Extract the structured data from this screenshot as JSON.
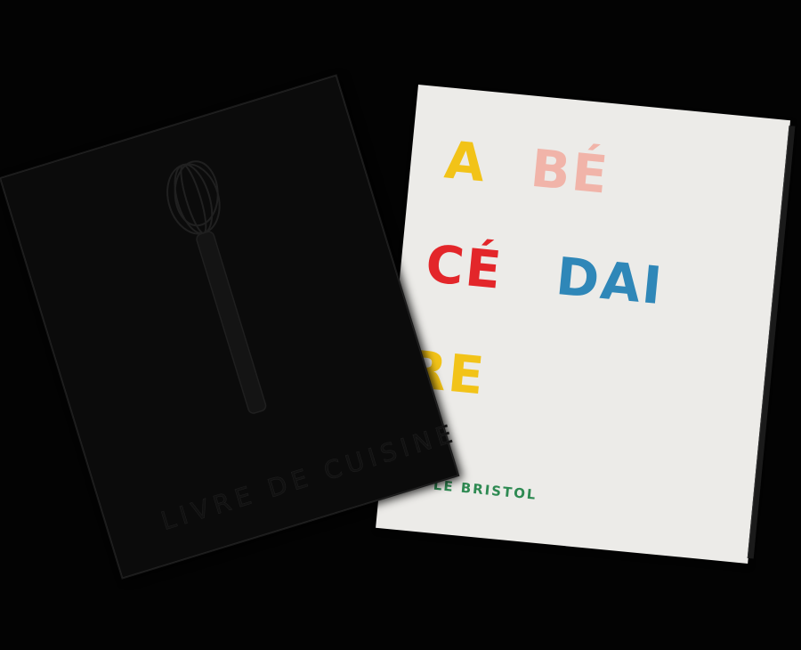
{
  "scene": {
    "background_color": "#000000"
  },
  "white_booklet": {
    "cover_color": "#ecebe8",
    "title_parts": [
      {
        "text": "A",
        "color": "#f2c318"
      },
      {
        "text": "BÉ",
        "color": "#f1b4a9"
      },
      {
        "text": "CÉ",
        "color": "#e3262a"
      },
      {
        "text": "DAI",
        "color": "#2f87b8"
      },
      {
        "text": "RE",
        "color": "#f2c318"
      }
    ],
    "publisher": {
      "text": "LE BRISTOL",
      "color": "#2e8a52"
    }
  },
  "dark_booklet": {
    "cover_color": "#0b0b0b",
    "title": "LIVRE DE CUISINE",
    "icon": "whisk-icon"
  }
}
